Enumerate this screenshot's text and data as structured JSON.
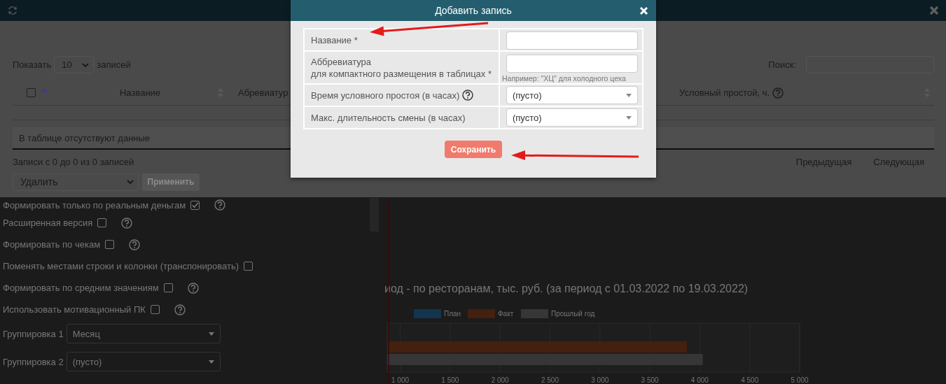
{
  "panel": {
    "length": {
      "before": "Показать",
      "value": "10",
      "after": "записей"
    },
    "search": {
      "label": "Поиск:"
    },
    "columns": [
      {
        "kind": "checkbox",
        "checked": false,
        "sorted": true
      },
      {
        "kind": "text",
        "label": "Название",
        "sorted": false
      },
      {
        "kind": "text",
        "label": "Абревиатур"
      },
      {
        "kind": "text",
        "label": "Условный простой, ч.",
        "help": true,
        "sorted": false
      }
    ],
    "empty_message": "В таблице отсутствуют данные",
    "info": "Записи с 0 до 0 из 0 записей",
    "bulk_action": {
      "value": "Удалить"
    },
    "apply_button": {
      "label": "Применить",
      "disabled": true
    },
    "pagination": [
      "Предыдущая",
      "Следующая"
    ]
  },
  "options": [
    {
      "kind": "checkbox",
      "label": "Формировать только по реальным деньгам",
      "checked": true,
      "help": true
    },
    {
      "kind": "checkbox",
      "label": "Расширенная версия",
      "checked": false,
      "help": true
    },
    {
      "kind": "checkbox",
      "label": "Формировать по чекам",
      "checked": false,
      "help": true
    },
    {
      "kind": "checkbox",
      "label": "Поменять местами строки и колонки (транспонировать)",
      "checked": false,
      "help": false
    },
    {
      "kind": "checkbox",
      "label": "Формировать по средним значениям",
      "checked": false,
      "help": true
    },
    {
      "kind": "checkbox",
      "label": "Использовать мотивационный ПК",
      "checked": false,
      "help": true
    },
    {
      "kind": "select",
      "label": "Группировка 1",
      "value": "Месяц"
    },
    {
      "kind": "select",
      "label": "Группировка 2",
      "value": "(пусто)"
    }
  ],
  "chart": {
    "chart_data": {
      "type": "bar",
      "orientation": "horizontal",
      "title": "иод - по ресторанам, тыс. руб. (за период с 01.03.2022 по 19.03.2022)",
      "series": [
        {
          "name": "План",
          "color": "#12344f",
          "values": [
            null
          ]
        },
        {
          "name": "Факт",
          "color": "#43200f",
          "values": [
            3870
          ]
        },
        {
          "name": "Прошлый год",
          "color": "#363636",
          "values": [
            4030
          ]
        }
      ],
      "xlim": [
        870,
        5000
      ],
      "grid": true,
      "legend": true,
      "xticks": [
        {
          "value": 1000,
          "label": "1 000"
        },
        {
          "value": 1500,
          "label": "1 500"
        },
        {
          "value": 2000,
          "label": "2 000"
        },
        {
          "value": 2500,
          "label": "2 500"
        },
        {
          "value": 3000,
          "label": "3 000"
        },
        {
          "value": 3500,
          "label": "3 500"
        },
        {
          "value": 4000,
          "label": "4 000"
        },
        {
          "value": 4500,
          "label": "4 500"
        },
        {
          "value": 5000,
          "label": "5 000"
        }
      ]
    }
  },
  "dialog": {
    "title": "Добавить запись",
    "fields": [
      {
        "kind": "input",
        "label": "Название *"
      },
      {
        "kind": "input",
        "label": "Аббревиатура\nдля компактного размещения в таблицах *",
        "hint": "Например: \"ХЦ\" для холодного цеха"
      },
      {
        "kind": "select",
        "label": "Время условного простоя (в часах)",
        "help": true,
        "value": "(пусто)"
      },
      {
        "kind": "select",
        "label": "Макс. длительность смены (в часах)",
        "value": "(пусто)"
      }
    ],
    "save_button": "Сохранить"
  }
}
